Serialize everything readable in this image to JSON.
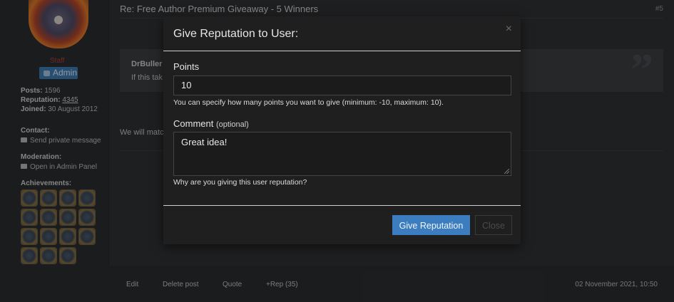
{
  "user": {
    "role_tag": "Staff",
    "badge": "Admin",
    "posts_label": "Posts:",
    "posts": "1596",
    "rep_label": "Reputation:",
    "reputation": "4345",
    "joined_label": "Joined:",
    "joined": "30 August 2012",
    "contact_heading": "Contact:",
    "send_pm": "Send private message",
    "moderation_heading": "Moderation:",
    "admin_panel": "Open in Admin Panel",
    "achievements_heading": "Achievements:"
  },
  "post": {
    "title": "Re: Free Author Premium Giveaway - 5 Winners",
    "number": "#5",
    "quote_author": "DrBuller",
    "quote_text": "If this tak",
    "body_text": "We will matc",
    "footer": {
      "edit": "Edit",
      "delete": "Delete post",
      "quote": "Quote",
      "rep": "+Rep (35)",
      "date": "02 November 2021, 10:50"
    }
  },
  "modal": {
    "title": "Give Reputation to User:",
    "close_x": "×",
    "points_label": "Points",
    "points_value": "10",
    "points_help": "You can specify how many points you want to give (minimum: -10, maximum: 10).",
    "comment_label": "Comment",
    "comment_optional": "(optional)",
    "comment_value": "Great idea!",
    "comment_help": "Why are you giving this user reputation?",
    "give_button": "Give Reputation",
    "close_button": "Close"
  },
  "colors": {
    "accent": "#3b7dbf",
    "admin_badge": "#3d7ab4",
    "modal_bg": "#1f1f1f",
    "page_bg": "#2f3133"
  }
}
